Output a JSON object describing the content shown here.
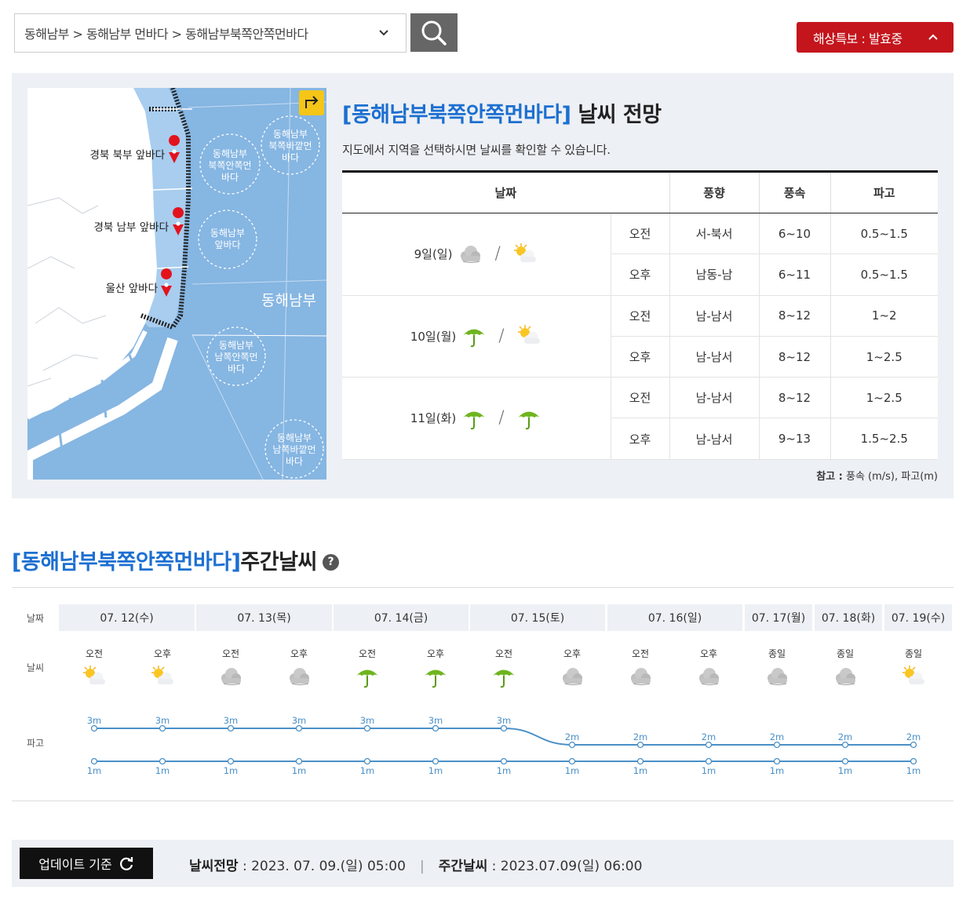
{
  "top": {
    "select_value": "동해남부 > 동해남부 먼바다 > 동해남부북쪽안쪽먼바다",
    "alert_label": "해상특보 : 발효중"
  },
  "map": {
    "markers": [
      "경북 북부 앞바다",
      "경북 남부 앞바다",
      "울산 앞바다"
    ],
    "zones": [
      [
        "동해남부",
        "북쪽안쪽먼",
        "바다"
      ],
      [
        "동해남부",
        "북쪽바깥먼",
        "바다"
      ],
      [
        "동해남부",
        "앞바다"
      ],
      [
        "동해남부",
        "남쪽안쪽먼",
        "바다"
      ],
      [
        "동해남부",
        "남쪽바깥먼",
        "바다"
      ]
    ],
    "region_label": "동해남부"
  },
  "forecast": {
    "title_area": "[동해남부북쪽안쪽먼바다]",
    "title_suffix": " 날씨 전망",
    "subtitle": "지도에서 지역을 선택하시면 날씨를 확인할 수 있습니다.",
    "headers": [
      "날짜",
      "풍향",
      "풍속",
      "파고"
    ],
    "rows": [
      {
        "day": "9일(일)",
        "icons": [
          "cloudy",
          "partly-sunny"
        ],
        "periods": [
          {
            "p": "오전",
            "dir": "서-북서",
            "speed": "6~10",
            "wave": "0.5~1.5"
          },
          {
            "p": "오후",
            "dir": "남동-남",
            "speed": "6~11",
            "wave": "0.5~1.5"
          }
        ]
      },
      {
        "day": "10일(월)",
        "icons": [
          "rain-umbrella",
          "partly-sunny"
        ],
        "periods": [
          {
            "p": "오전",
            "dir": "남-남서",
            "speed": "8~12",
            "wave": "1~2"
          },
          {
            "p": "오후",
            "dir": "남-남서",
            "speed": "8~12",
            "wave": "1~2.5"
          }
        ]
      },
      {
        "day": "11일(화)",
        "icons": [
          "rain-umbrella",
          "rain-umbrella"
        ],
        "periods": [
          {
            "p": "오전",
            "dir": "남-남서",
            "speed": "8~12",
            "wave": "1~2.5"
          },
          {
            "p": "오후",
            "dir": "남-남서",
            "speed": "9~13",
            "wave": "1.5~2.5"
          }
        ]
      }
    ],
    "note_label": "참고 :",
    "note_text": " 풍속 (m/s), 파고(m)"
  },
  "weekly": {
    "title_area": "[동해남부북쪽안쪽먼바다]",
    "title_suffix": " 주간날씨",
    "help": "?",
    "row_labels": {
      "date": "날짜",
      "weather": "날씨",
      "wave": "파고"
    },
    "dates": [
      "07. 12(수)",
      "07. 13(목)",
      "07. 14(금)",
      "07. 15(토)",
      "07. 16(일)",
      "07. 17(월)",
      "07. 18(화)",
      "07. 19(수)"
    ],
    "slots": [
      {
        "label": "오전",
        "icon": "partly-sunny",
        "max": 3,
        "min": 1
      },
      {
        "label": "오후",
        "icon": "partly-sunny",
        "max": 3,
        "min": 1
      },
      {
        "label": "오전",
        "icon": "cloudy",
        "max": 3,
        "min": 1
      },
      {
        "label": "오후",
        "icon": "cloudy",
        "max": 3,
        "min": 1
      },
      {
        "label": "오전",
        "icon": "rain-umbrella",
        "max": 3,
        "min": 1
      },
      {
        "label": "오후",
        "icon": "rain-umbrella",
        "max": 3,
        "min": 1
      },
      {
        "label": "오전",
        "icon": "rain-umbrella",
        "max": 3,
        "min": 1
      },
      {
        "label": "오후",
        "icon": "cloudy",
        "max": 2,
        "min": 1
      },
      {
        "label": "오전",
        "icon": "cloudy",
        "max": 2,
        "min": 1
      },
      {
        "label": "오후",
        "icon": "cloudy",
        "max": 2,
        "min": 1
      },
      {
        "label": "종일",
        "icon": "cloudy",
        "max": 2,
        "min": 1
      },
      {
        "label": "종일",
        "icon": "cloudy",
        "max": 2,
        "min": 1
      },
      {
        "label": "종일",
        "icon": "partly-sunny",
        "max": 2,
        "min": 1
      }
    ],
    "unit": "m"
  },
  "update": {
    "button": "업데이트 기준",
    "forecast_label": "날씨전망",
    "forecast_time": " : 2023. 07. 09.(일) 05:00",
    "weekly_label": "주간날씨",
    "weekly_time": " : 2023.07.09(일) 06:00",
    "sep": "|"
  },
  "colors": {
    "accent": "#1c6fd1",
    "alert": "#c4151c",
    "sea": "#86b6e2",
    "line": "#4a90c8"
  }
}
